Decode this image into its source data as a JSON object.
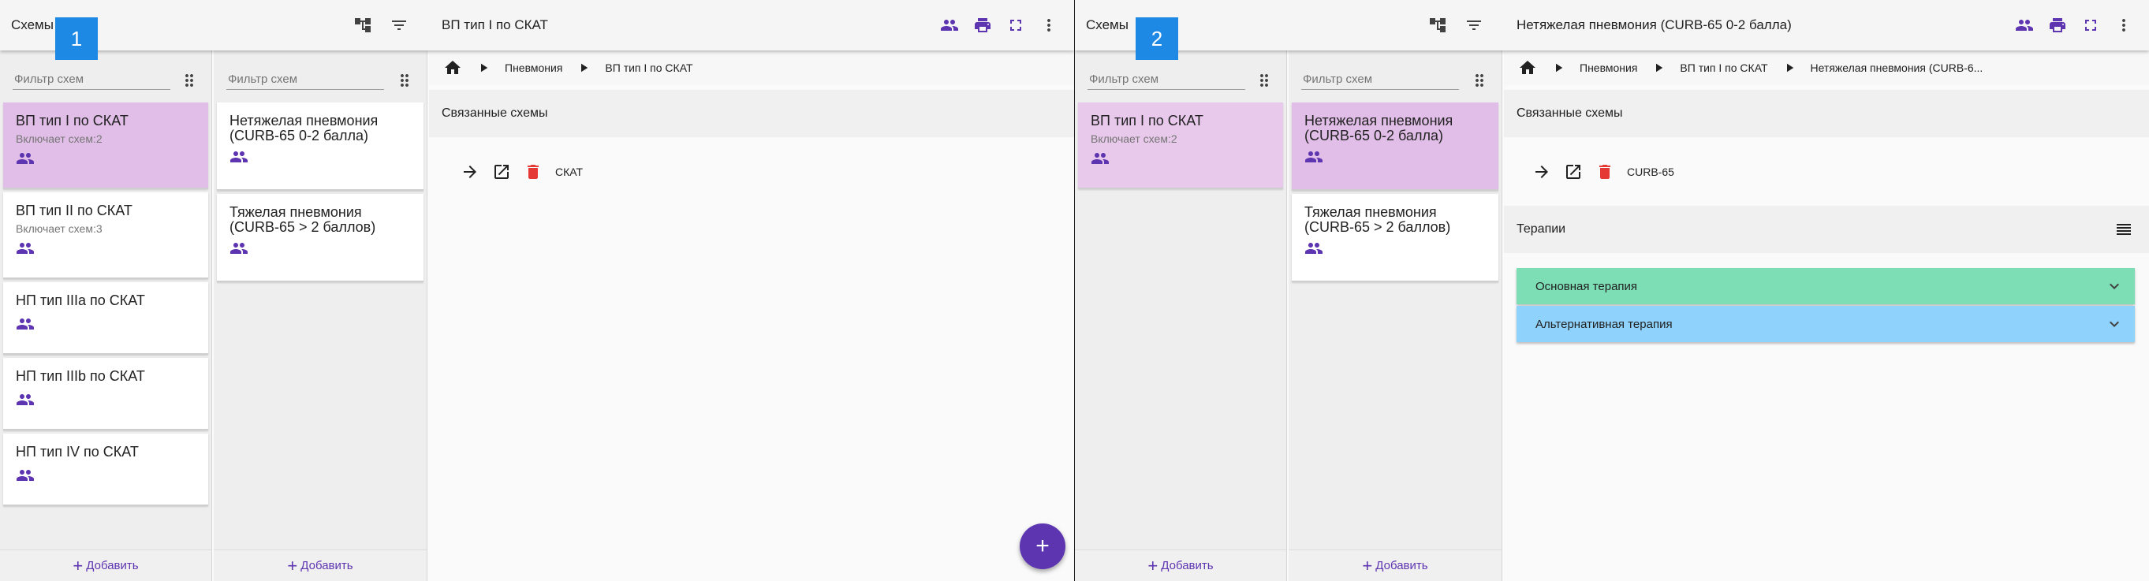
{
  "colors": {
    "accent": "#5e35b1",
    "selected_card": "#e1bee7",
    "badge_blue": "#1e88e5",
    "delete_red": "#e53935",
    "therapy_main": "#7dddb4",
    "therapy_alt": "#8fd2fb"
  },
  "screen1": {
    "badge": "1",
    "app_title": "Схемы",
    "scheme_title": "ВП тип I по СКАТ",
    "filter_placeholder": "Фильтр схем",
    "column1": [
      {
        "title": "ВП тип I по СКАТ",
        "sub": "Включает схем:2"
      },
      {
        "title": "ВП тип II по СКАТ",
        "sub": "Включает схем:3"
      },
      {
        "title": "НП тип IIIa по СКАТ",
        "sub": ""
      },
      {
        "title": "НП тип IIIb по СКАТ",
        "sub": ""
      },
      {
        "title": "НП тип IV по СКАТ",
        "sub": ""
      }
    ],
    "column2": [
      {
        "title": "Нетяжелая пневмония (CURB-65 0-2 балла)"
      },
      {
        "title": "Тяжелая пневмония (CURB-65 > 2 баллов)"
      }
    ],
    "add_label": "Добавить",
    "breadcrumbs": [
      "Пневмония",
      "ВП тип I по СКАТ"
    ],
    "related_header": "Связанные схемы",
    "related_item": "СКАТ"
  },
  "screen2": {
    "badge": "2",
    "app_title": "Схемы",
    "scheme_title": "Нетяжелая пневмония (CURB-65 0-2 балла)",
    "filter_placeholder": "Фильтр схем",
    "column1": [
      {
        "title": "ВП тип I по СКАТ",
        "sub": "Включает схем:2"
      }
    ],
    "column2": [
      {
        "title": "Нетяжелая пневмония (CURB-65 0-2 балла)"
      },
      {
        "title": "Тяжелая пневмония (CURB-65 > 2 баллов)"
      }
    ],
    "add_label": "Добавить",
    "breadcrumbs": [
      "Пневмония",
      "ВП тип I по СКАТ",
      "Нетяжелая пневмония (CURB-6..."
    ],
    "related_header": "Связанные схемы",
    "related_item": "CURB-65",
    "therapies_header": "Терапии",
    "therapies": [
      "Основная терапия",
      "Альтернативная терапия"
    ]
  }
}
